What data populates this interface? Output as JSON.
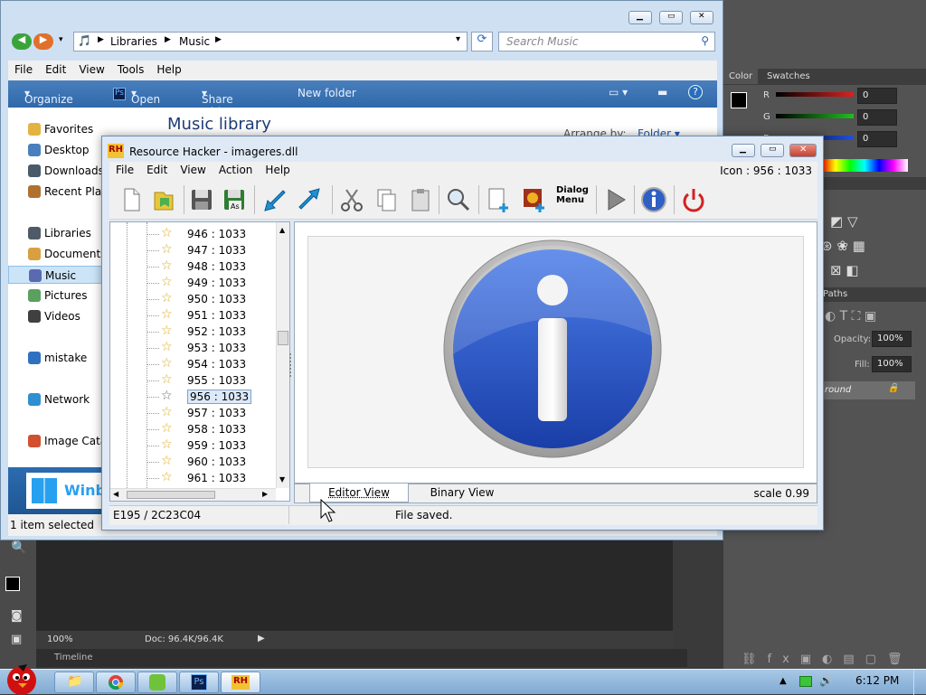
{
  "photoshop": {
    "panel_tabs": [
      "Color",
      "Swatches"
    ],
    "channels": [
      {
        "label": "R",
        "value": "0",
        "color": "#e02020"
      },
      {
        "label": "G",
        "value": "0",
        "color": "#20c020"
      },
      {
        "label": "B",
        "value": "0",
        "color": "#2050e0"
      }
    ],
    "paths_tab": "Paths",
    "opacity_label": "Opacity:",
    "opacity_value": "100%",
    "fill_label": "Fill:",
    "fill_value": "100%",
    "layer_name": "round",
    "zoom": "100%",
    "doc_info": "Doc: 96.4K/96.4K",
    "timeline": "Timeline"
  },
  "explorer": {
    "breadcrumb": [
      "Libraries",
      "Music"
    ],
    "search_placeholder": "Search Music",
    "menu": [
      "File",
      "Edit",
      "View",
      "Tools",
      "Help"
    ],
    "commands": [
      "Organize",
      "Open",
      "Share with",
      "New folder"
    ],
    "nav": [
      {
        "label": "Favorites",
        "color": "#e3b341"
      },
      {
        "label": "Desktop",
        "color": "#4a7fbd"
      },
      {
        "label": "Downloads",
        "color": "#4a5a6a"
      },
      {
        "label": "Recent Places",
        "color": "#b07030"
      },
      {
        "label": "Libraries",
        "color": "#505a66"
      },
      {
        "label": "Documents",
        "color": "#d8a040"
      },
      {
        "label": "Music",
        "color": "#5a6ab0"
      },
      {
        "label": "Pictures",
        "color": "#5aa060"
      },
      {
        "label": "Videos",
        "color": "#404040"
      },
      {
        "label": "mistake",
        "color": "#3070c0"
      },
      {
        "label": "Network",
        "color": "#2f8fd0"
      },
      {
        "label": "Image Catalog",
        "color": "#d05030"
      }
    ],
    "library_title": "Music library",
    "arrange_label": "Arrange by:",
    "arrange_value": "Folder",
    "status": "1 item selected",
    "banner": "Winbox"
  },
  "rh": {
    "title": "Resource Hacker - imageres.dll",
    "menu": [
      "File",
      "Edit",
      "View",
      "Action",
      "Help"
    ],
    "icon_info": "Icon : 956 : 1033",
    "toolbar": [
      "new-file",
      "open-file",
      "save",
      "save-as",
      "compile",
      "go-forward",
      "cut",
      "copy",
      "paste",
      "find",
      "add-resource",
      "add-image",
      "dialog-menu",
      "run",
      "about",
      "exit"
    ],
    "dialog_menu_label_1": "Dialog",
    "dialog_menu_label_2": "Menu",
    "tree": [
      "946 : 1033",
      "947 : 1033",
      "948 : 1033",
      "949 : 1033",
      "950 : 1033",
      "951 : 1033",
      "952 : 1033",
      "953 : 1033",
      "954 : 1033",
      "955 : 1033",
      "956 : 1033",
      "957 : 1033",
      "958 : 1033",
      "959 : 1033",
      "960 : 1033",
      "961 : 1033"
    ],
    "selected_index": 10,
    "tabs": [
      "Editor View",
      "Binary View"
    ],
    "scale": "scale 0.99",
    "status_left": "E195 / 2C23C04",
    "status_right": "File saved."
  },
  "taskbar": {
    "time": "6:12 PM",
    "apps": [
      "explorer",
      "chrome",
      "photo-app",
      "photoshop",
      "resource-hacker"
    ],
    "ps_label": "Ps",
    "rh_label": "RH"
  }
}
